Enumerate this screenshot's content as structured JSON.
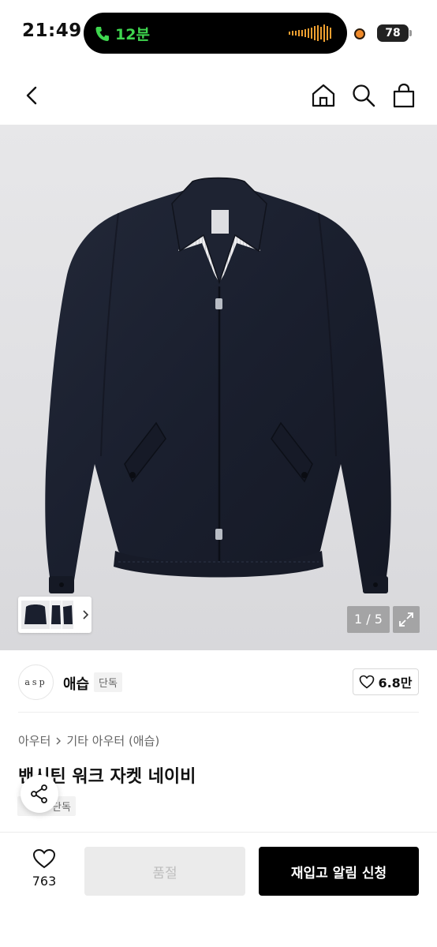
{
  "status_bar": {
    "time": "21:49",
    "call_duration": "12분",
    "battery": "78"
  },
  "nav": {
    "icons": [
      "back-icon",
      "home-icon",
      "search-icon",
      "shopping-bag-icon"
    ]
  },
  "gallery": {
    "counter": "1 / 5",
    "thumbnails_count": 3
  },
  "brand": {
    "logo_text": "asp",
    "name": "애습",
    "badge": "단독",
    "likes": "6.8만"
  },
  "product": {
    "breadcrumb": [
      "아우터",
      "기타 아우터 (애습)"
    ],
    "title": "밴시틴 워크 자켓 네이비",
    "badge": "단독"
  },
  "bottom_bar": {
    "wish_count": "763",
    "soldout_label": "품절",
    "restock_label": "재입고 알림 신청"
  },
  "colors": {
    "accent": "#000000",
    "call_green": "#3fd64f",
    "jacket_navy": "#1a1f2e"
  }
}
